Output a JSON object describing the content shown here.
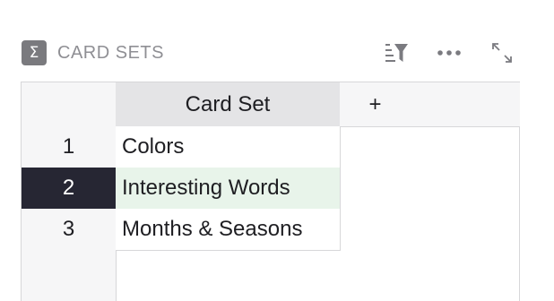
{
  "widget": {
    "icon": "sigma-icon",
    "title": "CARD SETS",
    "actions": [
      "sort-filter-icon",
      "more-options-icon",
      "expand-icon"
    ]
  },
  "table": {
    "columns": [
      "Card Set"
    ],
    "add_column_label": "+",
    "rows": [
      {
        "num": "1",
        "card_set": "Colors"
      },
      {
        "num": "2",
        "card_set": "Interesting Words"
      },
      {
        "num": "3",
        "card_set": "Months & Seasons"
      }
    ],
    "selected_row": "2"
  },
  "colors": {
    "selected_row_number_bg": "#262633",
    "selected_cell_bg": "#e8f4ea",
    "header_active_bg": "#e4e4e6",
    "grid_line": "#d7d7d9"
  }
}
